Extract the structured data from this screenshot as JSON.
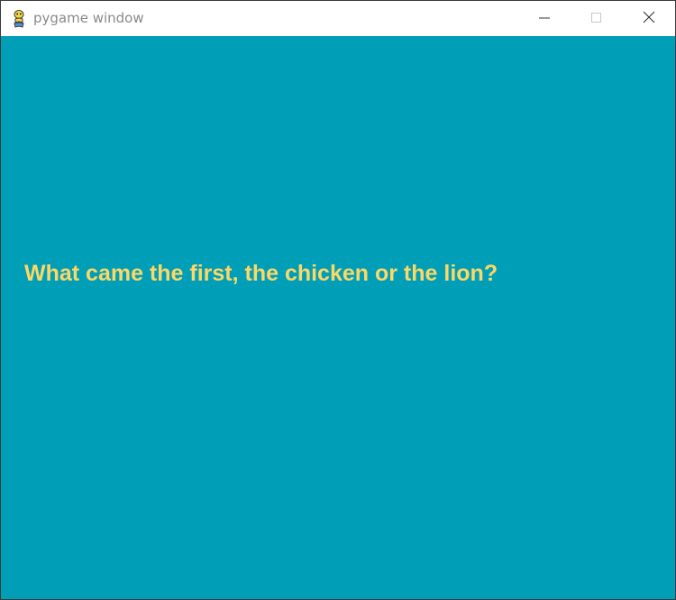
{
  "window": {
    "title": "pygame window",
    "icon": "pygame-snake-icon",
    "controls": [
      "minimize-icon",
      "maximize-icon",
      "close-icon"
    ]
  },
  "game": {
    "question": "What came the first, the chicken or the lion?"
  },
  "colors": {
    "background": "#009fb7",
    "question_text": "#fed766",
    "titlebar": "#ffffff",
    "title_text": "#8a8a8a"
  }
}
